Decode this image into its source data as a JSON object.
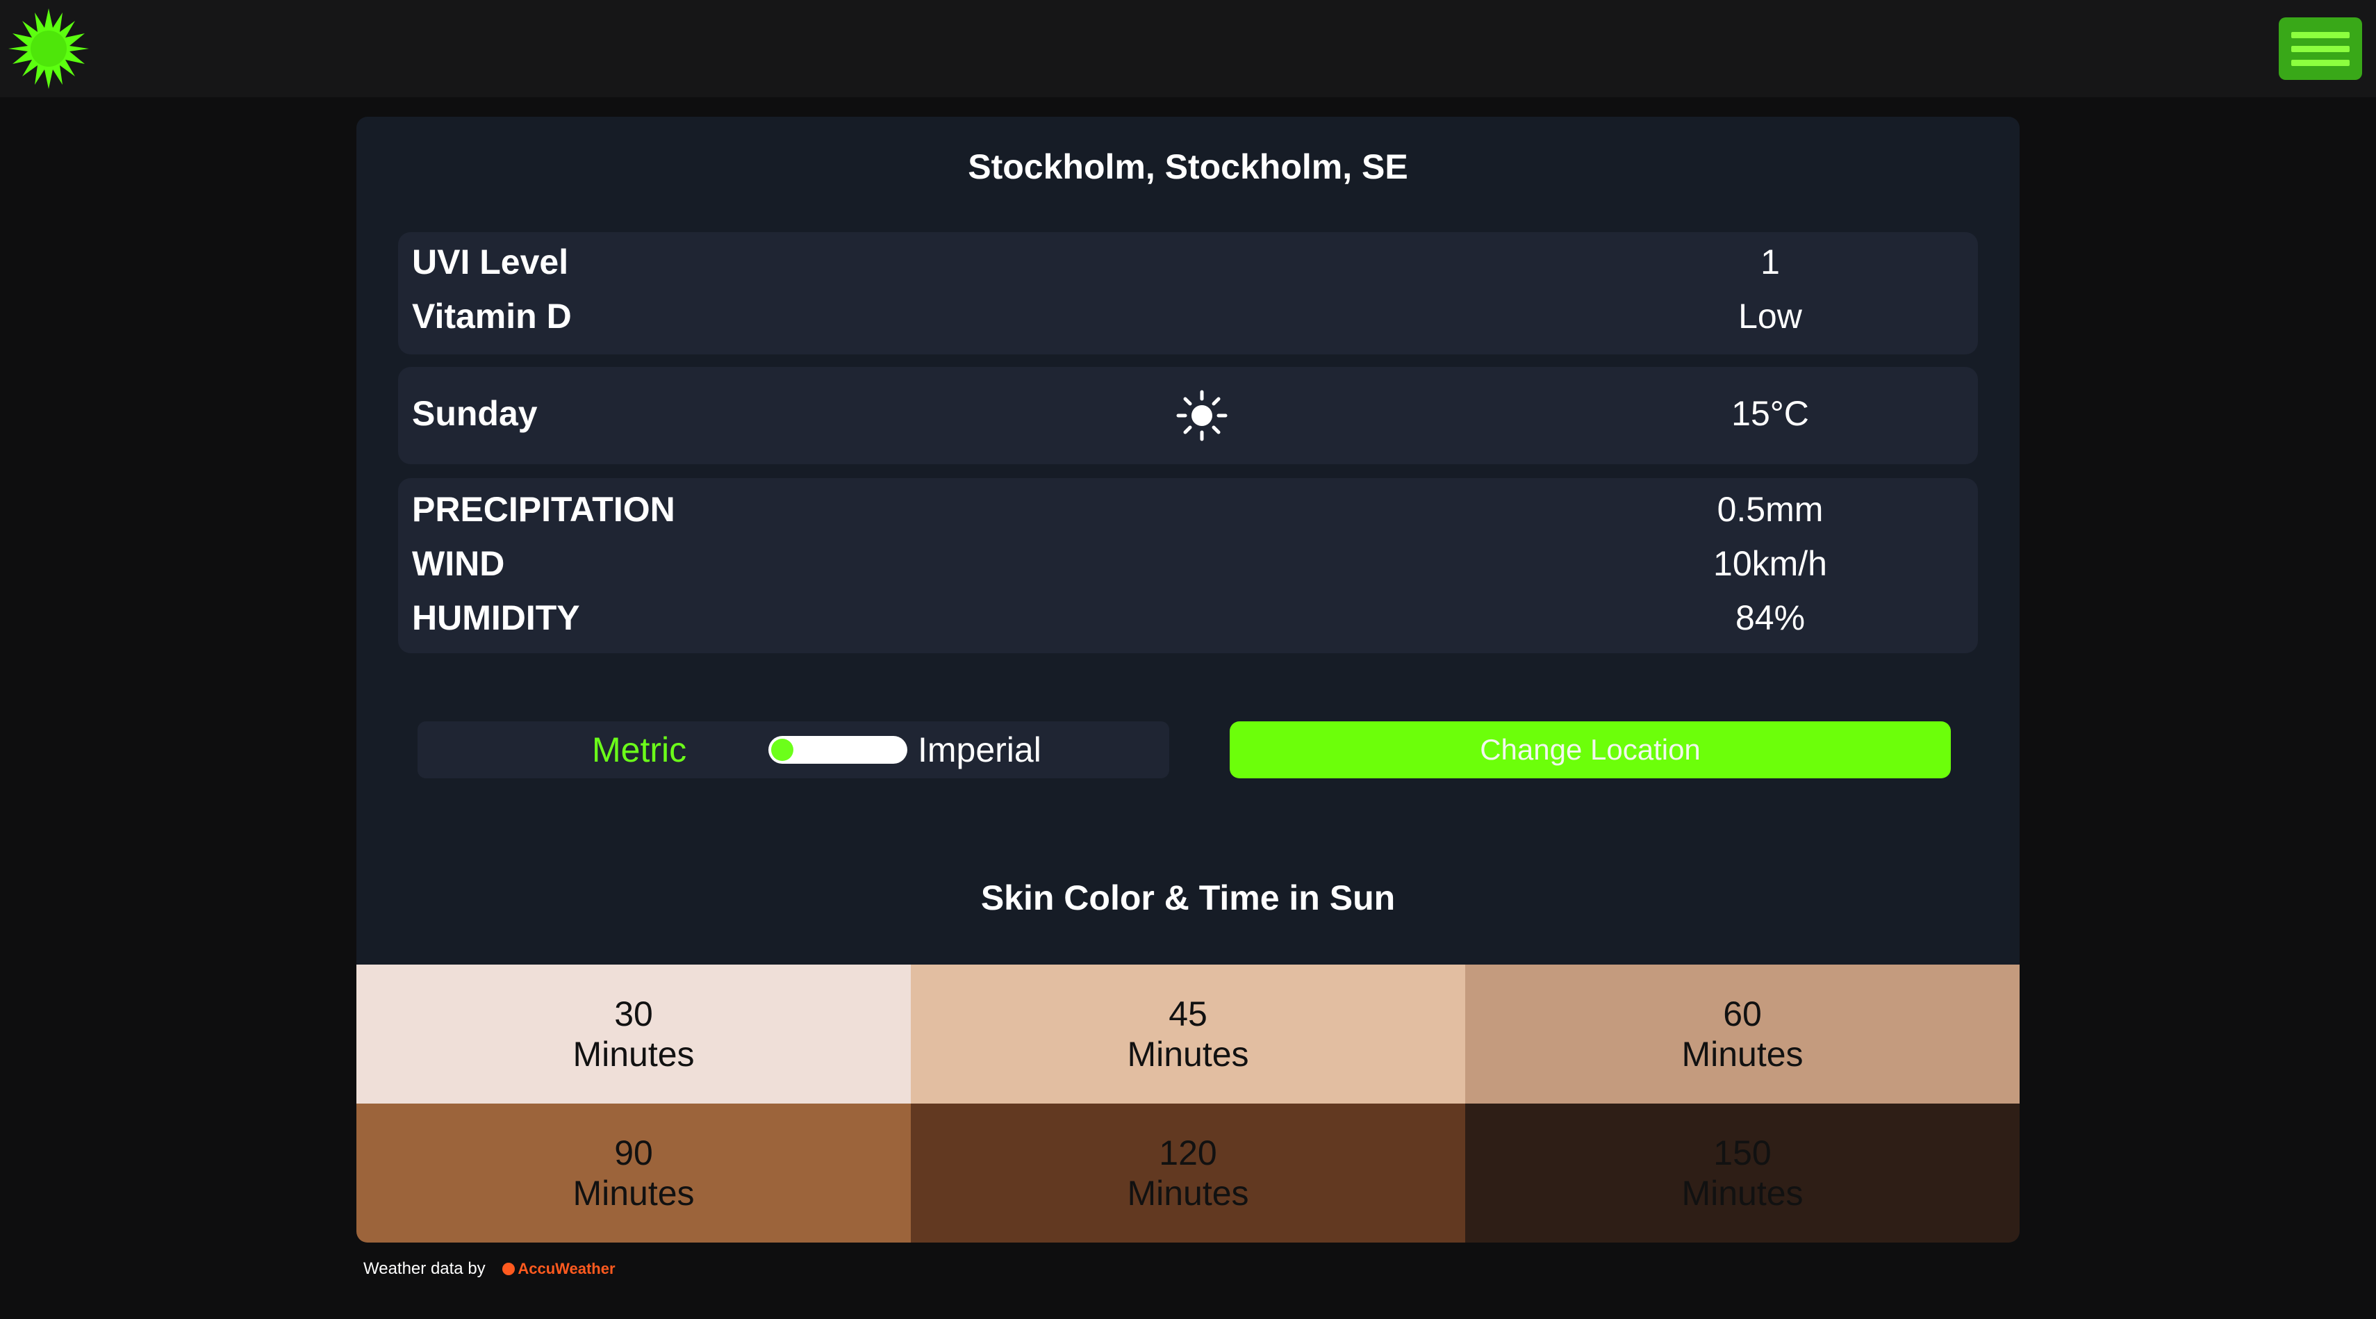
{
  "header": {
    "logo_icon": "green-sun-logo-icon",
    "menu_icon": "hamburger-menu-icon"
  },
  "location": {
    "title": "Stockholm, Stockholm, SE"
  },
  "uv": {
    "uvi_label": "UVI Level",
    "uvi_value": "1",
    "vitd_label": "Vitamin D",
    "vitd_value": "Low"
  },
  "forecast": {
    "day": "Sunday",
    "condition_icon": "sun-icon",
    "temperature": "15°C"
  },
  "details": {
    "precip_label": "PRECIPITATION",
    "precip_value": "0.5mm",
    "wind_label": "WIND",
    "wind_value": "10km/h",
    "humidity_label": "HUMIDITY",
    "humidity_value": "84%"
  },
  "units": {
    "metric_label": "Metric",
    "imperial_label": "Imperial",
    "selected": "Metric"
  },
  "actions": {
    "change_location_label": "Change Location"
  },
  "skin": {
    "title": "Skin Color & Time in Sun",
    "cells": [
      {
        "minutes": "30",
        "unit": "Minutes",
        "color": "#efdfd8",
        "text_color": "#111111"
      },
      {
        "minutes": "45",
        "unit": "Minutes",
        "color": "#e2bea1",
        "text_color": "#111111"
      },
      {
        "minutes": "60",
        "unit": "Minutes",
        "color": "#c49b7e",
        "text_color": "#111111"
      },
      {
        "minutes": "90",
        "unit": "Minutes",
        "color": "#9c643b",
        "text_color": "#111111"
      },
      {
        "minutes": "120",
        "unit": "Minutes",
        "color": "#623921",
        "text_color": "#111111"
      },
      {
        "minutes": "150",
        "unit": "Minutes",
        "color": "#2e1e16",
        "text_color": "#111111"
      }
    ]
  },
  "footer": {
    "text": "Weather data by",
    "brand": "AccuWeather"
  },
  "colors": {
    "accent": "#6cff0a",
    "background": "#0e0e0f",
    "card": "#161c26",
    "panel": "#1f2533"
  }
}
